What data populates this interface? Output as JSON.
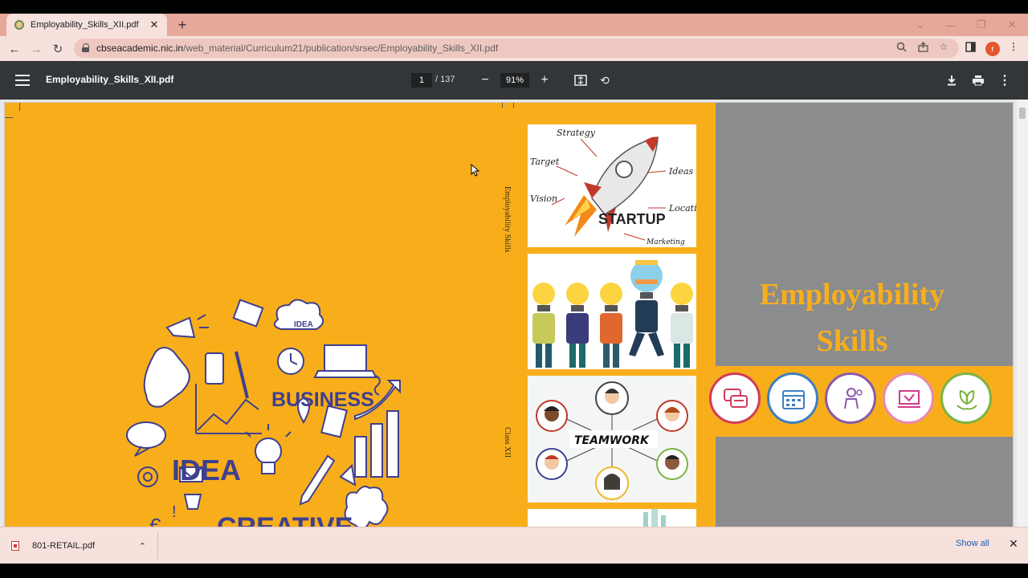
{
  "browser": {
    "tab_title": "Employability_Skills_XII.pdf",
    "new_tab": "+",
    "url_host": "cbseacademic.nic.in",
    "url_path": "/web_material/Curriculum21/publication/srsec/Employability_Skills_XII.pdf",
    "profile_initial": "r"
  },
  "pdf_viewer": {
    "file_name": "Employability_Skills_XII.pdf",
    "current_page": "1",
    "total_pages": "/ 137",
    "zoom": "91%"
  },
  "document": {
    "spine_title": "Employability Skills",
    "spine_class": "Class XII",
    "cover_title_line1": "Employability",
    "cover_title_line2": "Skills",
    "doodle_words": [
      "IDEA",
      "BUSINESS",
      "IDEA",
      "CREATIVE"
    ],
    "startup_labels": [
      "Strategy",
      "Target",
      "Ideas",
      "Vision",
      "STARTUP",
      "Location",
      "Marketing"
    ],
    "teamwork_label": "TEAMWORK",
    "colors": {
      "cover_orange": "#f8ae1b",
      "grey_panel": "#8a8c8e",
      "doodle_ink": "#3e3f8f"
    }
  },
  "downloads": {
    "item": "801-RETAIL.pdf",
    "show_all": "Show all"
  }
}
